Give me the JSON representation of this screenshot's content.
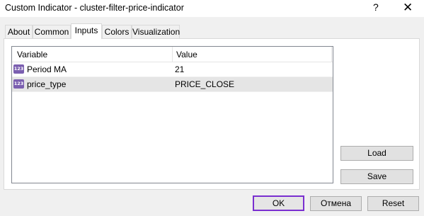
{
  "window": {
    "title": "Custom Indicator - cluster-filter-price-indicator",
    "help_glyph": "?",
    "close_glyph": "✕"
  },
  "tabs": [
    {
      "label": "About"
    },
    {
      "label": "Common"
    },
    {
      "label": "Inputs",
      "active": true
    },
    {
      "label": "Colors"
    },
    {
      "label": "Visualization"
    }
  ],
  "grid": {
    "columns": [
      "Variable",
      "Value"
    ],
    "rows": [
      {
        "icon": "123",
        "variable": "Period MA",
        "value": "21"
      },
      {
        "icon": "123",
        "variable": "price_type",
        "value": "PRICE_CLOSE",
        "selected": true
      }
    ]
  },
  "side_buttons": {
    "load": "Load",
    "save": "Save"
  },
  "footer": {
    "ok": "OK",
    "cancel": "Отмена",
    "reset": "Reset"
  },
  "colors": {
    "accent": "#7a2fd0",
    "selection": "#e5e5e5",
    "icon": "#7b5fb0"
  }
}
